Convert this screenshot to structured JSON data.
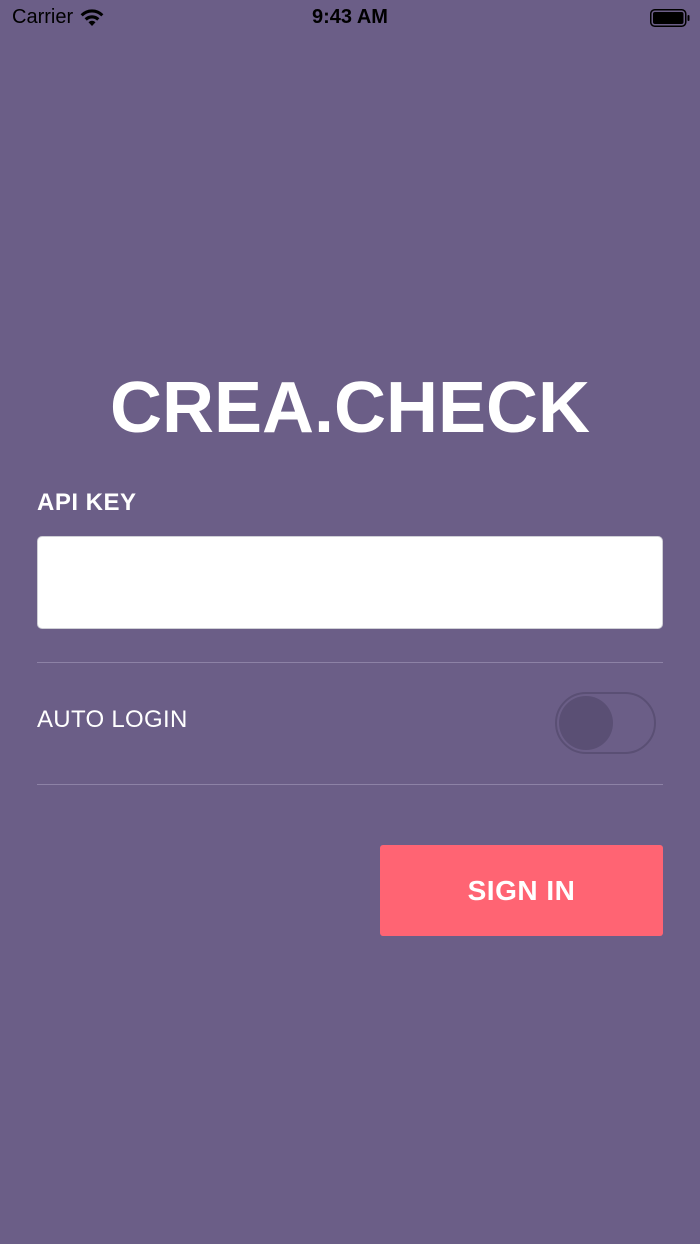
{
  "status_bar": {
    "carrier": "Carrier",
    "time": "9:43 AM",
    "wifi_icon": "wifi-icon",
    "battery_icon": "battery-icon"
  },
  "app": {
    "logo": "CREA.CHECK"
  },
  "form": {
    "api_key_label": "API KEY",
    "api_key_value": "",
    "api_key_placeholder": "",
    "auto_login_label": "AUTO LOGIN",
    "auto_login_enabled": false,
    "sign_in_label": "SIGN IN"
  },
  "colors": {
    "background": "#6b5e87",
    "button": "#ff6473",
    "toggle_off": "#5a4f74"
  }
}
